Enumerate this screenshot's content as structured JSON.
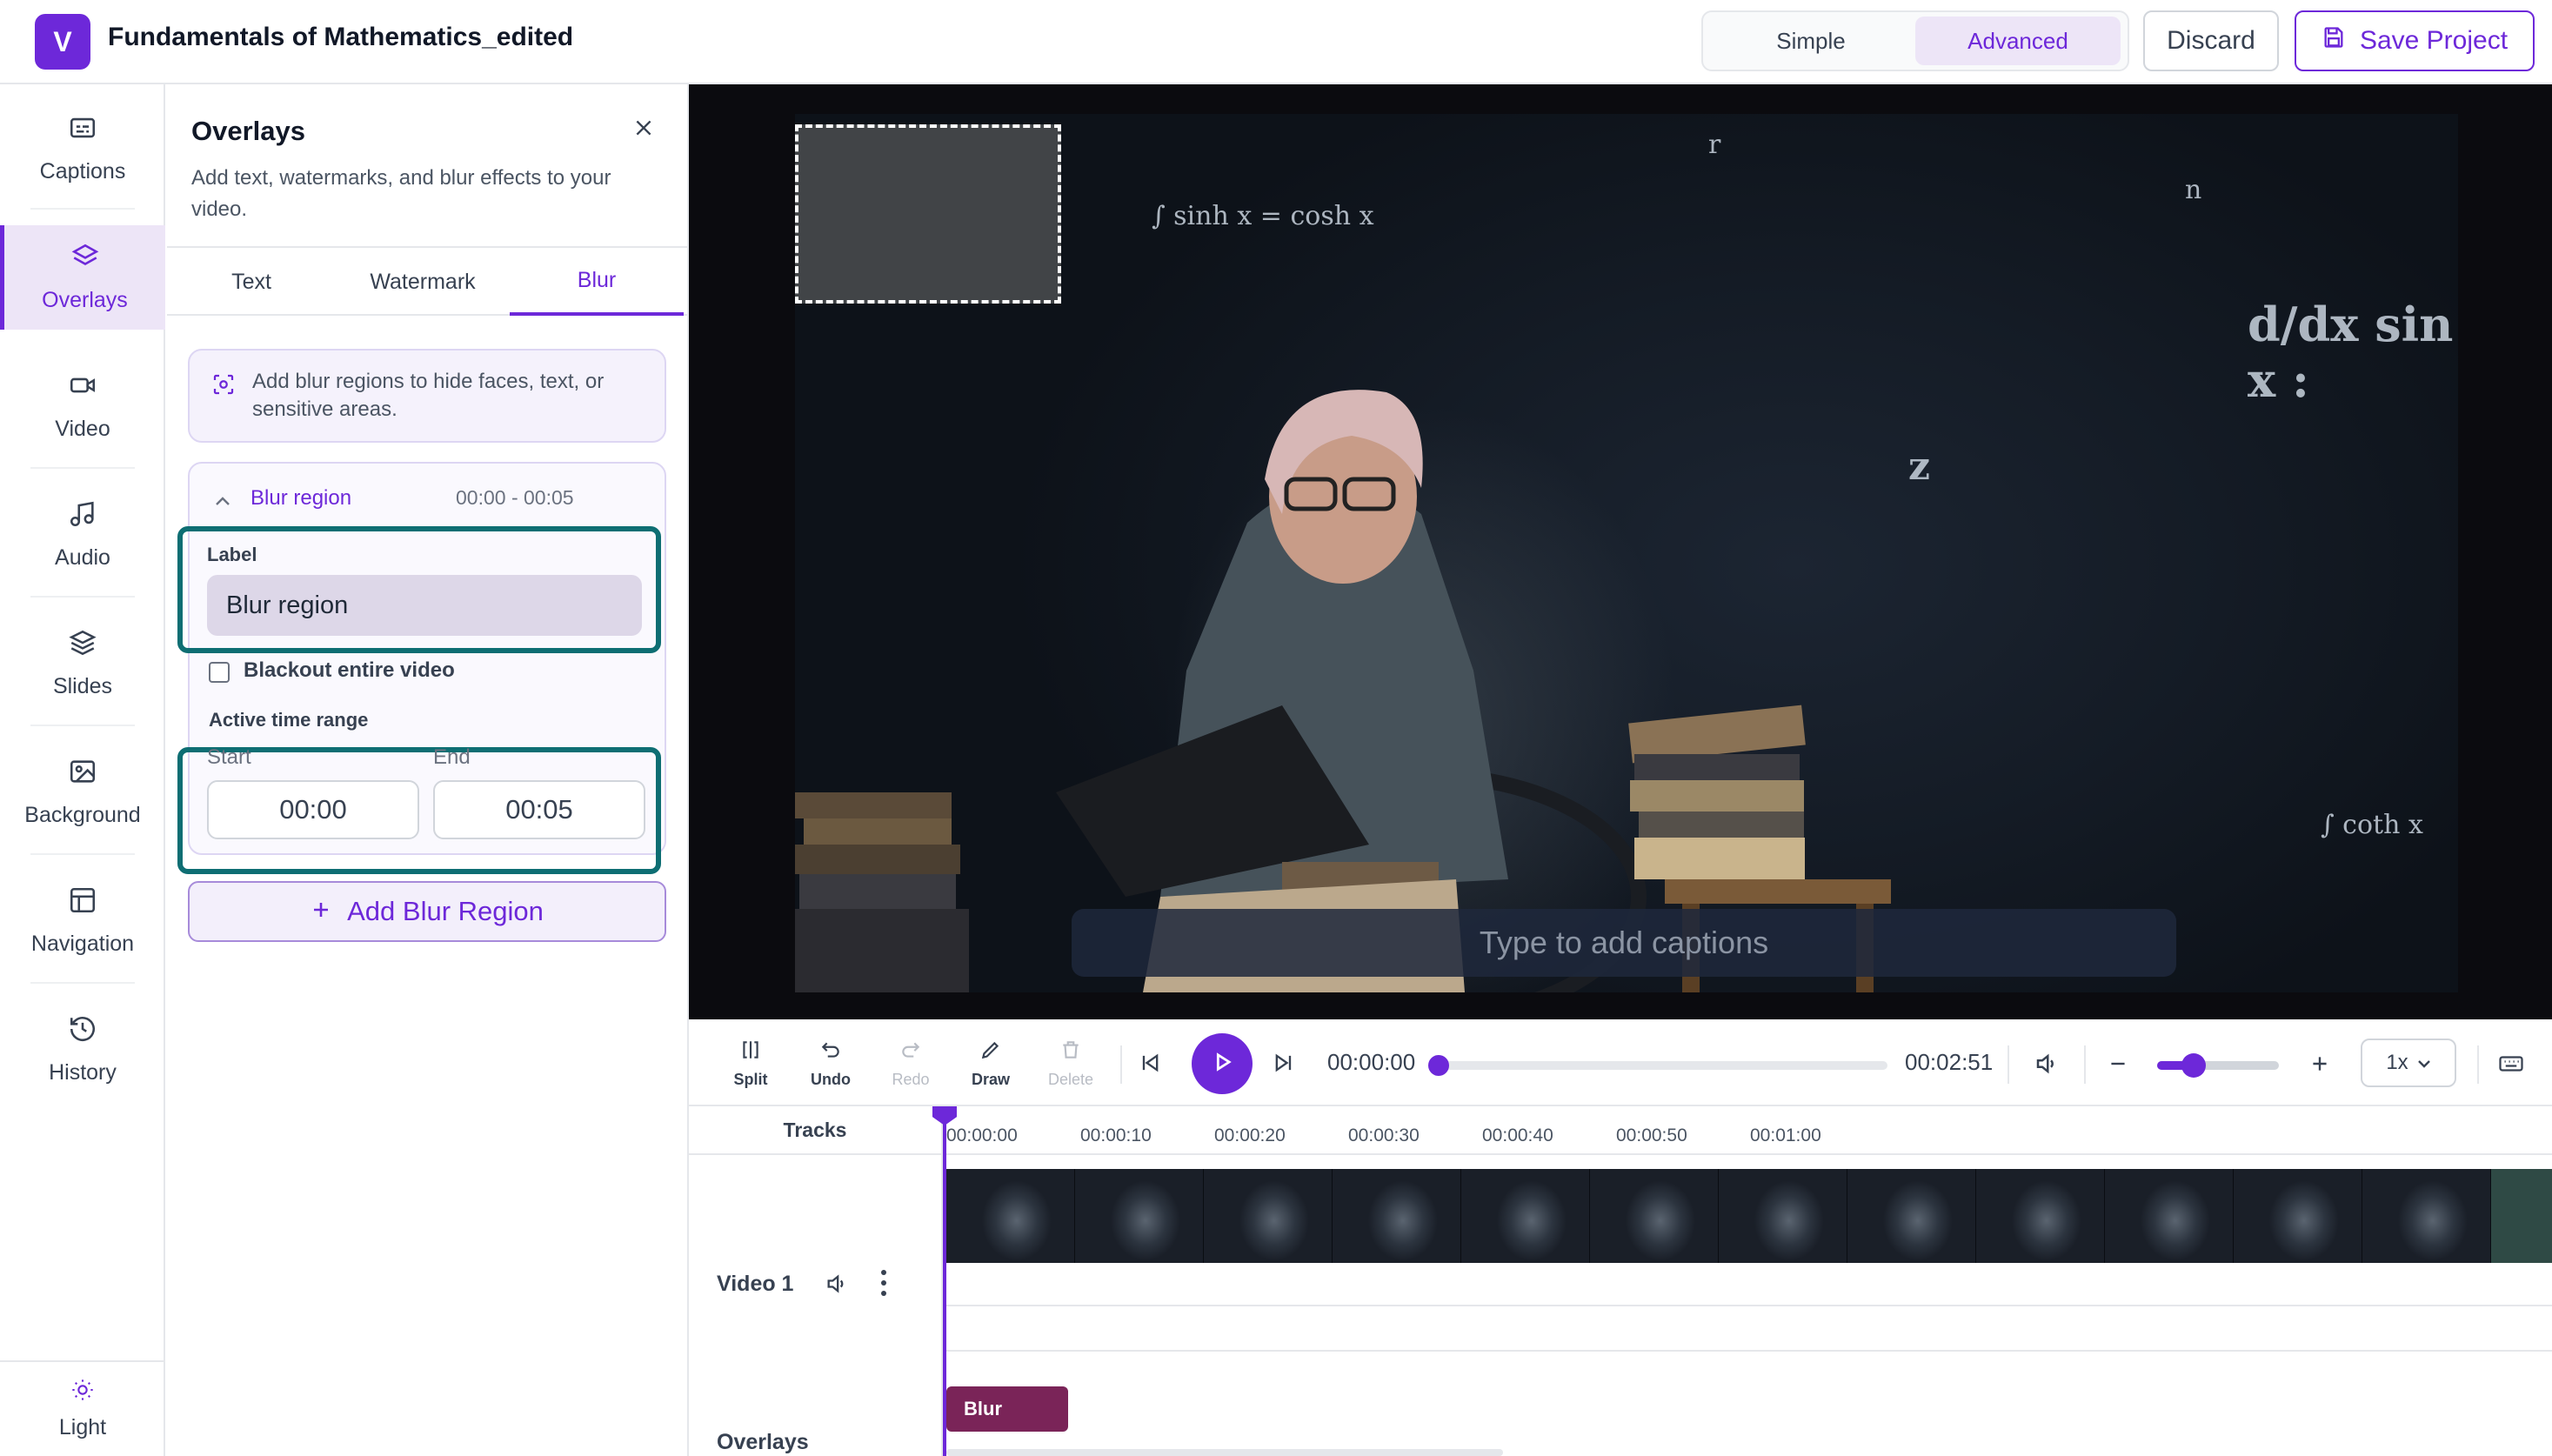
{
  "header": {
    "logo_letter": "V",
    "project_title": "Fundamentals of Mathematics_edited",
    "mode_simple": "Simple",
    "mode_advanced": "Advanced",
    "active_mode": "Advanced",
    "discard_label": "Discard",
    "save_label": "Save Project"
  },
  "sidebar": {
    "items": [
      {
        "label": "Captions",
        "icon": "captions-icon"
      },
      {
        "label": "Overlays",
        "icon": "layers-icon",
        "active": true
      },
      {
        "label": "Video",
        "icon": "video-camera-icon"
      },
      {
        "label": "Audio",
        "icon": "music-note-icon"
      },
      {
        "label": "Slides",
        "icon": "stack-icon"
      },
      {
        "label": "Background",
        "icon": "image-icon"
      },
      {
        "label": "Navigation",
        "icon": "layout-icon"
      },
      {
        "label": "History",
        "icon": "history-icon"
      }
    ],
    "theme_label": "Light",
    "theme_icon": "sun-icon"
  },
  "panel": {
    "title": "Overlays",
    "description": "Add text, watermarks, and blur effects to your video.",
    "tabs": [
      "Text",
      "Watermark",
      "Blur"
    ],
    "active_tab": "Blur",
    "info_text": "Add blur regions to hide faces, text, or sensitive areas.",
    "region": {
      "name": "Blur region",
      "time_range": "00:00 - 00:05",
      "label_field_label": "Label",
      "label_value": "Blur region",
      "blackout_label": "Blackout entire video",
      "blackout_checked": false,
      "active_range_label": "Active time range",
      "start_label": "Start",
      "start_value": "00:00",
      "end_label": "End",
      "end_value": "00:05"
    },
    "add_button_label": "Add Blur Region"
  },
  "preview": {
    "caption_placeholder": "Type to add captions",
    "formulas": [
      "∫ sinh x = cosh x",
      "d/dx sin x :",
      "z",
      "∫ coth x",
      "r",
      "n"
    ]
  },
  "transport": {
    "tools": [
      {
        "label": "Split",
        "enabled": true
      },
      {
        "label": "Undo",
        "enabled": true
      },
      {
        "label": "Redo",
        "enabled": false
      },
      {
        "label": "Draw",
        "enabled": true
      },
      {
        "label": "Delete",
        "enabled": false
      }
    ],
    "current_time": "00:00:00",
    "total_time": "00:02:51",
    "progress": 0.0,
    "zoom_level": 0.3,
    "speed": "1x"
  },
  "timeline": {
    "tracks_header": "Tracks",
    "ticks": [
      "00:00:00",
      "00:00:10",
      "00:00:20",
      "00:00:30",
      "00:00:40",
      "00:00:50",
      "00:01:00"
    ],
    "tracks": [
      {
        "name": "Video 1"
      },
      {
        "name": "Overlays"
      }
    ],
    "overlay_clip": "Blur"
  },
  "colors": {
    "accent": "#6d28d9",
    "highlight": "#0e6e73",
    "blur_clip": "#7a2458"
  }
}
